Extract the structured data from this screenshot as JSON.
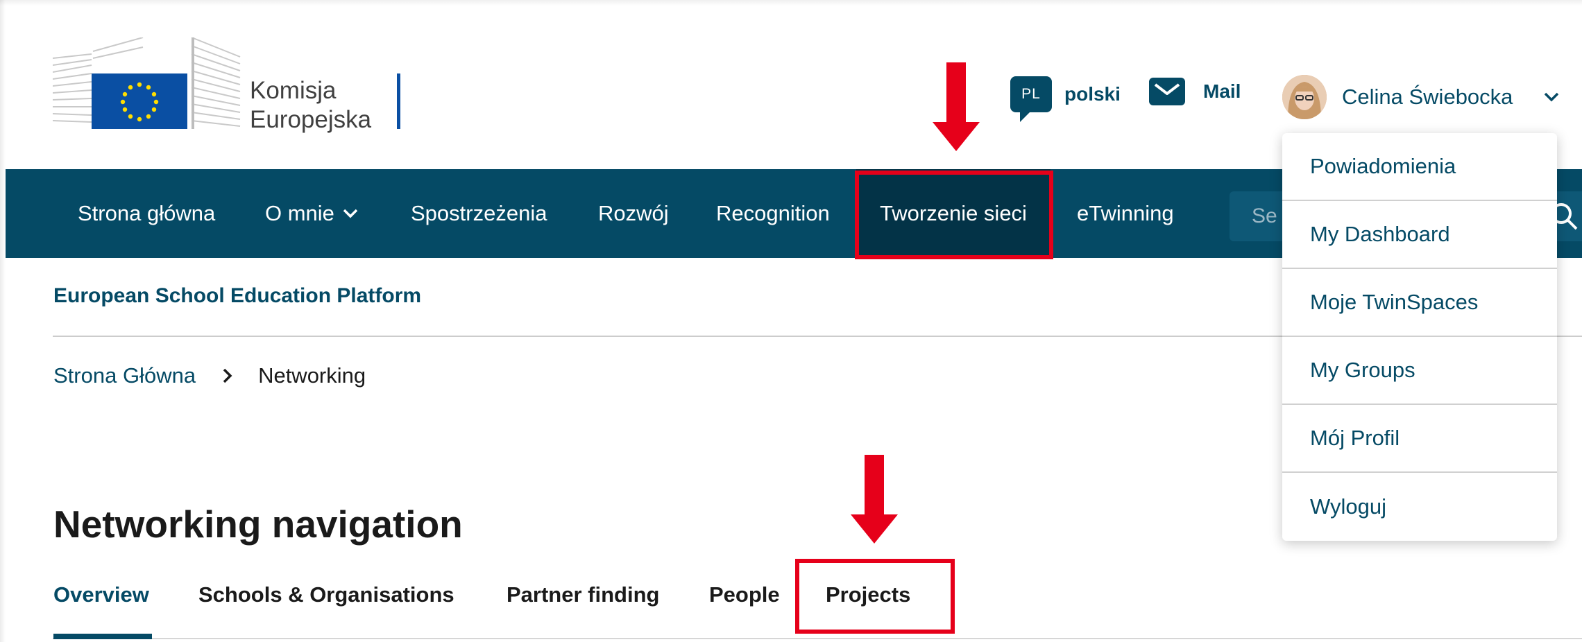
{
  "header": {
    "logo_line1": "Komisja",
    "logo_line2": "Europejska",
    "language_code": "PL",
    "language_label": "polski",
    "mail_label": "Mail",
    "user_name": "Celina Świebocka"
  },
  "nav": {
    "items": [
      {
        "label": "Strona główna"
      },
      {
        "label": "O mnie"
      },
      {
        "label": "Spostrzeżenia"
      },
      {
        "label": "Rozwój"
      },
      {
        "label": "Recognition"
      },
      {
        "label": "Tworzenie sieci"
      },
      {
        "label": "eTwinning"
      }
    ],
    "search_placeholder": "Se"
  },
  "user_menu": {
    "items": [
      {
        "label": "Powiadomienia"
      },
      {
        "label": "My Dashboard"
      },
      {
        "label": "Moje TwinSpaces"
      },
      {
        "label": "My Groups"
      },
      {
        "label": "Mój Profil"
      },
      {
        "label": "Wyloguj"
      }
    ]
  },
  "site_name": "European School Education Platform",
  "breadcrumb": {
    "home": "Strona Główna",
    "current": "Networking"
  },
  "page_title": "Networking navigation",
  "tabs": [
    {
      "label": "Overview"
    },
    {
      "label": "Schools & Organisations"
    },
    {
      "label": "Partner finding"
    },
    {
      "label": "People"
    },
    {
      "label": "Projects"
    }
  ],
  "colors": {
    "brand": "#054a65",
    "highlight": "#e6001a",
    "eu_blue": "#0a4fa3",
    "eu_star": "#ffde00"
  }
}
